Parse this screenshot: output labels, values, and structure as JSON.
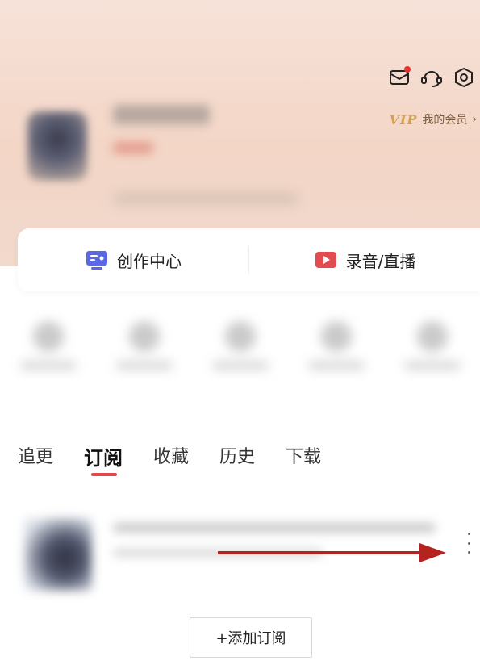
{
  "header": {
    "vip_logo": "VIP",
    "vip_label": "我的会员",
    "vip_chevron": "›",
    "icons": [
      "mail-icon",
      "customer-service-icon",
      "settings-icon"
    ],
    "accent_color": "#e5322d"
  },
  "quick_card": {
    "left_label": "创作中心",
    "right_label": "录音/直播"
  },
  "tabs": [
    {
      "label": "追更",
      "active": false
    },
    {
      "label": "订阅",
      "active": true
    },
    {
      "label": "收藏",
      "active": false
    },
    {
      "label": "历史",
      "active": false
    },
    {
      "label": "下载",
      "active": false
    }
  ],
  "subscription": {
    "add_label": "+添加订阅"
  }
}
